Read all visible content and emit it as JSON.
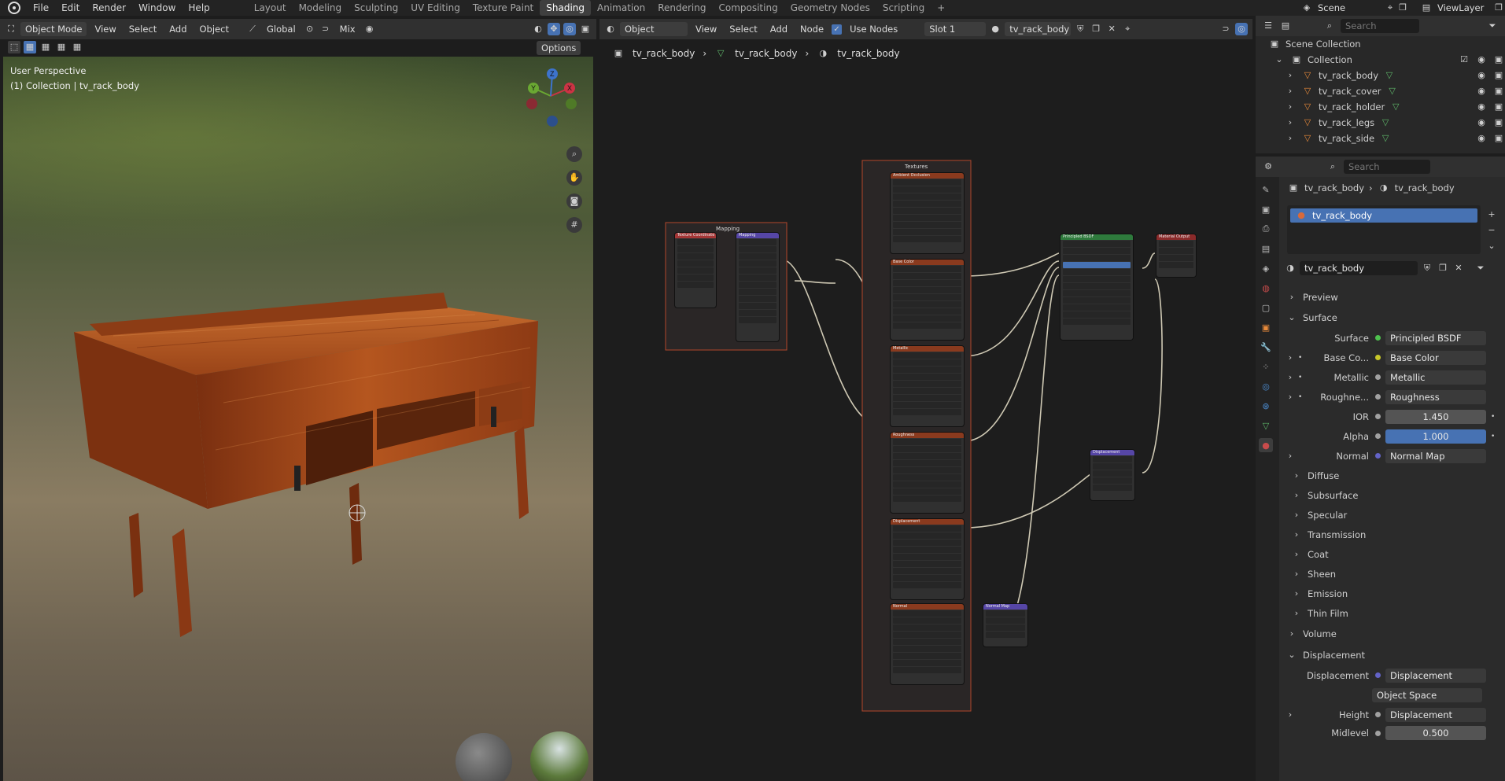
{
  "topbar": {
    "menus": [
      "File",
      "Edit",
      "Render",
      "Window",
      "Help"
    ],
    "workspaces": [
      "Layout",
      "Modeling",
      "Sculpting",
      "UV Editing",
      "Texture Paint",
      "Shading",
      "Animation",
      "Rendering",
      "Compositing",
      "Geometry Nodes",
      "Scripting"
    ],
    "active_workspace": "Shading",
    "add_tab": "+",
    "scene": "Scene",
    "view_layer": "ViewLayer"
  },
  "viewport": {
    "mode": "Object Mode",
    "menus": [
      "View",
      "Select",
      "Add",
      "Object"
    ],
    "orientation": "Global",
    "snap_mode": "Mix",
    "options": "Options",
    "overlay_text_1": "User Perspective",
    "overlay_text_2": "(1) Collection | tv_rack_body",
    "gizmo_axes": [
      "X",
      "Y",
      "Z"
    ]
  },
  "node_editor": {
    "type_select": "Object",
    "menus": [
      "View",
      "Select",
      "Add",
      "Node"
    ],
    "use_nodes_label": "Use Nodes",
    "slot": "Slot 1",
    "material": "tv_rack_body",
    "breadcrumb": [
      "tv_rack_body",
      "tv_rack_body",
      "tv_rack_body"
    ],
    "frames": {
      "textures": "Textures",
      "mapping": "Mapping"
    },
    "nodes": {
      "texcoord": "Texture Coordinate",
      "mapping": "Mapping",
      "tex_nodes": [
        "Ambient Occlusion",
        "Base Color",
        "Metallic",
        "Roughness",
        "Displacement",
        "Normal"
      ],
      "bsdf": "Principled BSDF",
      "output": "Material Output",
      "displacement": "Displacement",
      "normal_map": "Normal Map"
    }
  },
  "outliner": {
    "search_placeholder": "Search",
    "scene_collection": "Scene Collection",
    "collection": "Collection",
    "objects": [
      "tv_rack_body",
      "tv_rack_cover",
      "tv_rack_holder",
      "tv_rack_legs",
      "tv_rack_side"
    ]
  },
  "properties": {
    "search_placeholder": "Search",
    "breadcrumb": [
      "tv_rack_body",
      "tv_rack_body"
    ],
    "slot_item": "tv_rack_body",
    "material_name": "tv_rack_body",
    "sections": {
      "preview": "Preview",
      "surface": "Surface",
      "volume": "Volume",
      "displacement": "Displacement"
    },
    "surface_rows": [
      {
        "label": "Surface",
        "value": "Principled BSDF",
        "sock": "#4ec14e",
        "expand": false,
        "dot": false
      },
      {
        "label": "Base Co...",
        "value": "Base Color",
        "sock": "#c7c729",
        "expand": true,
        "dot": true
      },
      {
        "label": "Metallic",
        "value": "Metallic",
        "sock": "#a1a1a1",
        "expand": true,
        "dot": true
      },
      {
        "label": "Roughne...",
        "value": "Roughness",
        "sock": "#a1a1a1",
        "expand": true,
        "dot": true
      }
    ],
    "ior": {
      "label": "IOR",
      "value": "1.450"
    },
    "alpha": {
      "label": "Alpha",
      "value": "1.000"
    },
    "normal": {
      "label": "Normal",
      "value": "Normal Map"
    },
    "subpanels": [
      "Diffuse",
      "Subsurface",
      "Specular",
      "Transmission",
      "Coat",
      "Sheen",
      "Emission",
      "Thin Film"
    ],
    "disp_rows": {
      "displacement_label": "Displacement",
      "displacement_value": "Displacement",
      "space": "Object Space",
      "height_label": "Height",
      "height_value": "Displacement",
      "midlevel_label": "Midlevel",
      "midlevel_value": "0.500"
    }
  },
  "colors": {
    "accent_blue": "#4772b3",
    "tex_header": "#8a3a1e",
    "frame_border": "#b3462a",
    "bsdf_header": "#2e7a3c",
    "vector_header": "#5646a6",
    "wire": "#cfc9b4"
  }
}
